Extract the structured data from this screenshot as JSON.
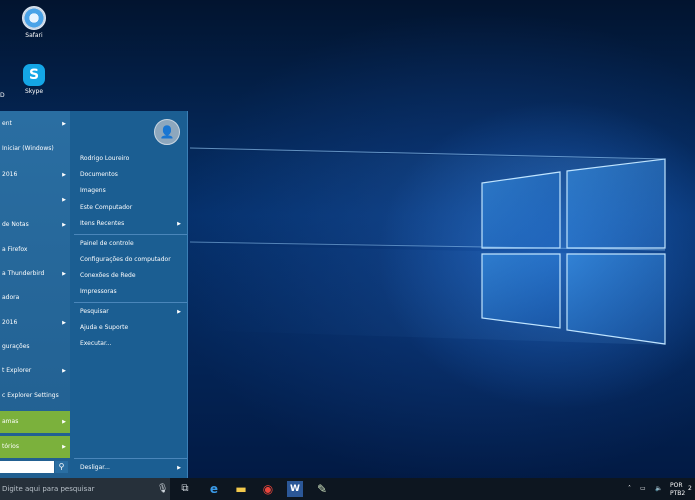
{
  "desktop": {
    "icons": [
      {
        "label": "Safari"
      },
      {
        "label": "Skype"
      }
    ],
    "partial_label": "D"
  },
  "start_menu": {
    "left_items": [
      {
        "label": "ent",
        "has_arrow": true
      },
      {
        "label": "Iniciar (Windows)",
        "has_arrow": false
      },
      {
        "label": "2016",
        "has_arrow": true
      },
      {
        "label": "",
        "has_arrow": true
      },
      {
        "label": "de Notas",
        "has_arrow": true
      },
      {
        "label": "a Firefox",
        "has_arrow": false
      },
      {
        "label": "a Thunderbird",
        "has_arrow": true
      },
      {
        "label": "adora",
        "has_arrow": false
      },
      {
        "label": "2016",
        "has_arrow": true
      },
      {
        "label": "gurações",
        "has_arrow": false
      },
      {
        "label": "t Explorer",
        "has_arrow": true
      },
      {
        "label": "c Explorer Settings",
        "has_arrow": false
      },
      {
        "label": "amas",
        "has_arrow": true
      },
      {
        "label": "tórios",
        "has_arrow": true
      }
    ],
    "right_items": [
      {
        "label": "Rodrigo Loureiro",
        "has_arrow": false
      },
      {
        "label": "Documentos",
        "has_arrow": false
      },
      {
        "label": "Imagens",
        "has_arrow": false
      },
      {
        "label": "Este Computador",
        "has_arrow": false
      },
      {
        "label": "Itens Recentes",
        "has_arrow": true
      },
      {
        "label": "Painel de controle",
        "has_arrow": false
      },
      {
        "label": "Configurações do computador",
        "has_arrow": false
      },
      {
        "label": "Conexões de Rede",
        "has_arrow": false
      },
      {
        "label": "Impressoras",
        "has_arrow": false
      },
      {
        "label": "Pesquisar",
        "has_arrow": true
      },
      {
        "label": "Ajuda e Suporte",
        "has_arrow": false
      },
      {
        "label": "Executar...",
        "has_arrow": false
      }
    ],
    "shutdown_label": "Desligar..."
  },
  "taskbar": {
    "search_placeholder": "Digite aqui para pesquisar",
    "lang": "POR",
    "layout": "PTB2",
    "time": "2"
  },
  "colors": {
    "menu_bg": "#1b5e92",
    "green_highlight": "#7bb13c",
    "taskbar_bg": "#0d1620"
  }
}
